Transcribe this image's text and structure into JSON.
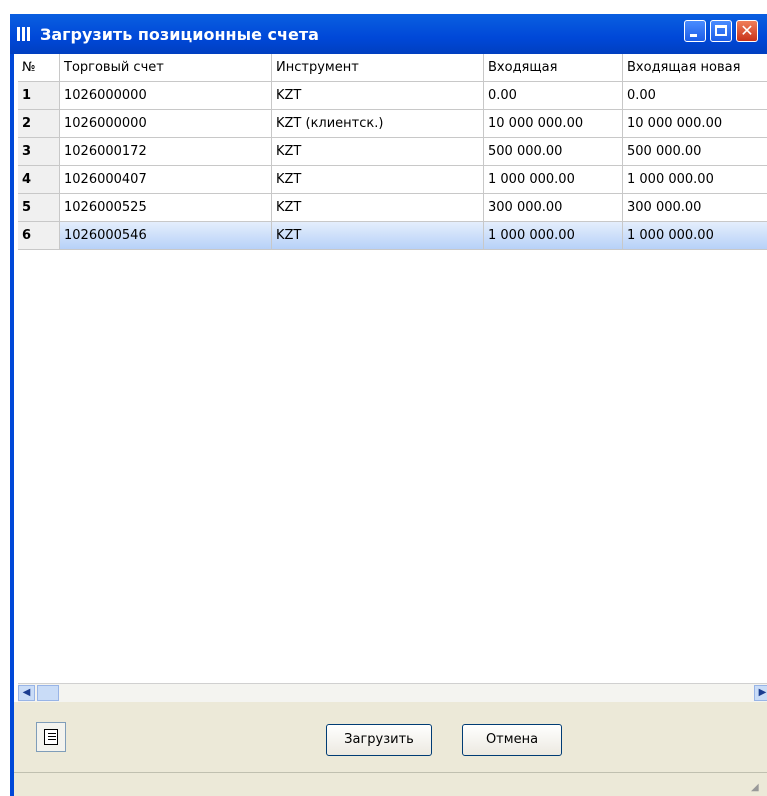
{
  "window": {
    "title": "Загрузить позиционные счета"
  },
  "columns": [
    "№",
    "Торговый счет",
    "Инструмент",
    "Входящая",
    "Входящая новая"
  ],
  "rows": [
    {
      "num": "1",
      "account": "1026000000",
      "instrument": "KZT",
      "incoming": "0.00",
      "incoming_new": "0.00"
    },
    {
      "num": "2",
      "account": "1026000000",
      "instrument": "KZT (клиентск.)",
      "incoming": "10 000 000.00",
      "incoming_new": "10 000 000.00"
    },
    {
      "num": "3",
      "account": "1026000172",
      "instrument": "KZT",
      "incoming": "500 000.00",
      "incoming_new": "500 000.00"
    },
    {
      "num": "4",
      "account": "1026000407",
      "instrument": "KZT",
      "incoming": "1 000 000.00",
      "incoming_new": "1 000 000.00"
    },
    {
      "num": "5",
      "account": "1026000525",
      "instrument": "KZT",
      "incoming": "300 000.00",
      "incoming_new": "300 000.00"
    },
    {
      "num": "6",
      "account": "1026000546",
      "instrument": "KZT",
      "incoming": "1 000 000.00",
      "incoming_new": "1 000 000.00"
    }
  ],
  "selected_row": "6",
  "buttons": {
    "load": "Загрузить",
    "cancel": "Отмена"
  },
  "icons": [
    "app-columns-icon",
    "minimize-icon",
    "maximize-icon",
    "close-icon",
    "scroll-left-icon",
    "scroll-right-icon",
    "report-icon"
  ],
  "colors": {
    "titlebar": "#0048d8",
    "selected_row": "#b7d1f8",
    "close_button": "#c8321a"
  }
}
